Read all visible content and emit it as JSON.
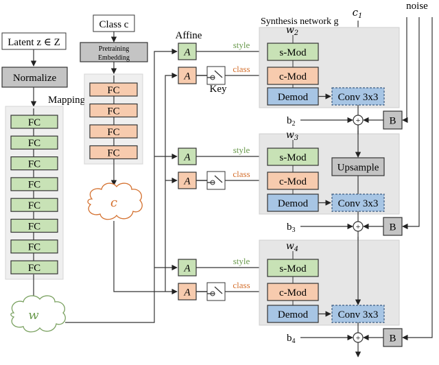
{
  "colors": {
    "green_fill": "#c8e2b6",
    "orange_fill": "#f7cbae",
    "blue_fill": "#a7c5e4",
    "gray_fill": "#c4c4c4",
    "panel_fill": "#e6e6e6",
    "panel_light": "#efefef",
    "stroke": "#333333",
    "green_text": "#6a9a4d",
    "orange_text": "#d4702e"
  },
  "inputs": {
    "latent": "Latent z ∈ Z",
    "class": "Class c",
    "noise": "noise"
  },
  "mapping": {
    "normalize": "Normalize",
    "label": "Mapping",
    "fc_labels": [
      "FC",
      "FC",
      "FC",
      "FC",
      "FC",
      "FC",
      "FC",
      "FC"
    ],
    "w_symbol": "w"
  },
  "class_branch": {
    "embedding_line1": "Pretraining",
    "embedding_line2": "Embedding",
    "fc_labels": [
      "FC",
      "FC",
      "FC",
      "FC"
    ],
    "c_symbol": "c"
  },
  "affine": {
    "label": "Affine",
    "a_symbol": "A",
    "key_label": "Key",
    "style_label": "style",
    "class_label": "class"
  },
  "synthesis": {
    "title": "Synthesis network g",
    "c1": "c",
    "c1_sub": "1",
    "blocks": [
      {
        "w": "w",
        "w_sub": "2",
        "smod": "s-Mod",
        "cmod": "c-Mod",
        "demod": "Demod",
        "conv": "Conv 3x3",
        "bias": "b",
        "bias_sub": "2",
        "noise_box": "B"
      },
      {
        "w": "w",
        "w_sub": "3",
        "smod": "s-Mod",
        "cmod": "c-Mod",
        "demod": "Demod",
        "conv": "Conv 3x3",
        "upsample": "Upsample",
        "bias": "b",
        "bias_sub": "3",
        "noise_box": "B"
      },
      {
        "w": "w",
        "w_sub": "4",
        "smod": "s-Mod",
        "cmod": "c-Mod",
        "demod": "Demod",
        "conv": "Conv 3x3",
        "bias": "b",
        "bias_sub": "4",
        "noise_box": "B"
      }
    ],
    "plus": "+",
    "continuation": "..."
  }
}
